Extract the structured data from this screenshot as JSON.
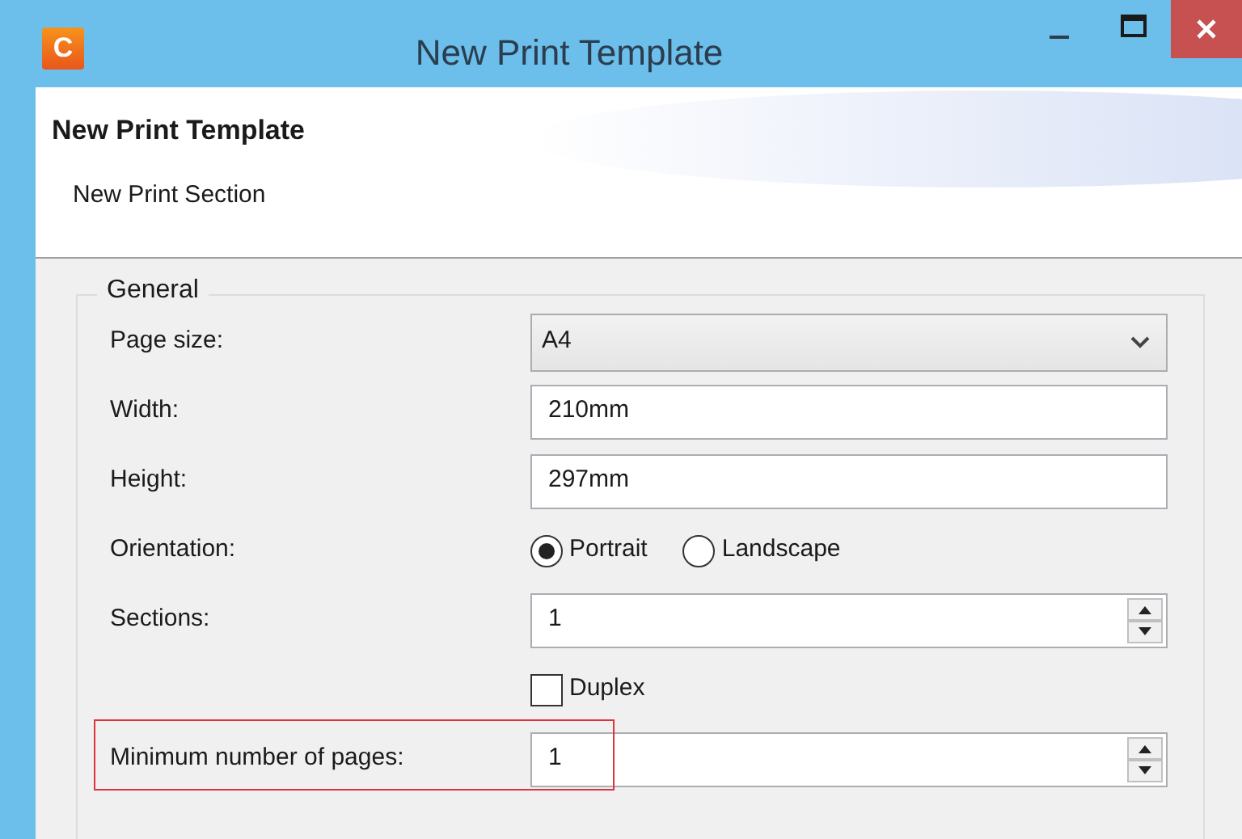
{
  "window": {
    "title": "New Print Template",
    "icon_letter": "C"
  },
  "header": {
    "title": "New Print Template",
    "subtitle": "New Print Section"
  },
  "group": {
    "legend": "General",
    "rows": [
      {
        "kind": "select",
        "label": "Page size:",
        "value": "A4"
      },
      {
        "kind": "text",
        "label": "Width:",
        "value": "210mm"
      },
      {
        "kind": "text",
        "label": "Height:",
        "value": "297mm"
      },
      {
        "kind": "radio",
        "label": "Orientation:",
        "options": [
          {
            "label": "Portrait",
            "selected": true
          },
          {
            "label": "Landscape",
            "selected": false
          }
        ]
      },
      {
        "kind": "spin",
        "label": "Sections:",
        "value": "1",
        "highlighted": false
      },
      {
        "kind": "checkbox",
        "label": "Duplex",
        "checked": false
      },
      {
        "kind": "spin",
        "label": "Minimum number of pages:",
        "value": "1",
        "highlighted": true
      }
    ]
  }
}
